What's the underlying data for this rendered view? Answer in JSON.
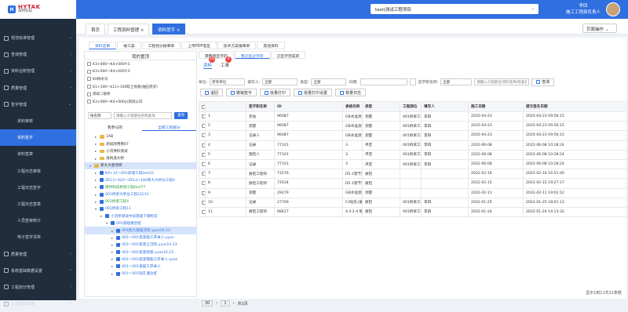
{
  "brand": {
    "name": "HYTAK",
    "sub": "海特科技"
  },
  "header": {
    "project": "test(测试工程项目",
    "user_name": "李四",
    "user_role": "施工工程部负责人"
  },
  "sidebar": [
    {
      "label": "规范标准管理",
      "arrow": "›"
    },
    {
      "label": "查询管理",
      "arrow": "›"
    },
    {
      "label": "资料台账管理",
      "arrow": "›"
    },
    {
      "label": "质量管理",
      "arrow": "›"
    },
    {
      "label": "签字管理",
      "arrow": "⌄"
    },
    {
      "label": "资料审核",
      "sub": true
    },
    {
      "label": "资料签字",
      "sub": true,
      "active": true
    },
    {
      "label": "资料签章",
      "sub": true
    },
    {
      "label": "工程日志审核",
      "sub": true
    },
    {
      "label": "工程日志签字",
      "sub": true
    },
    {
      "label": "工程日志签章",
      "sub": true
    },
    {
      "label": "人员签审统计",
      "sub": true
    },
    {
      "label": "电子签字清单",
      "sub": true
    },
    {
      "label": "质量管理",
      "arrow": "›"
    },
    {
      "label": "系统基础数据设置",
      "arrow": "›"
    },
    {
      "label": "工程划分管理",
      "arrow": "›"
    },
    {
      "label": "工程基础数据",
      "arrow": "›"
    }
  ],
  "tabs": [
    {
      "label": "首页",
      "close": ""
    },
    {
      "label": "工程资料管理",
      "close": "×"
    },
    {
      "label": "资料签字",
      "close": "×",
      "active": true
    }
  ],
  "page_ops": "页面操作 ⌄",
  "subtabs": [
    "资料签审",
    "竣工案",
    "工程划分报审章",
    "上传PDF电签",
    "技术方案报审单",
    "其他资料"
  ],
  "left_panel": {
    "title": "我的置顶",
    "pinned": [
      "K3+000～K4+000Y-3",
      "K3+000～K4+000Y-3",
      "K0桥水沟",
      "K1+100～k11+100软土地基(抽石挤淤)",
      "测试二级桥",
      "K3+000～K4+000y(测试公司"
    ],
    "filter_field": "按名称",
    "filter_placeholder": "请输入工程部位名称查询",
    "query": "查询",
    "tabs": [
      "我参与的",
      "全部工程部分"
    ],
    "tree": [
      {
        "t": "1AB",
        "lvl": 1,
        "type": "folder"
      },
      {
        "t": "测试改用例07",
        "lvl": 1,
        "type": "folder"
      },
      {
        "t": "小流供料测试",
        "lvl": 1,
        "type": "folder"
      },
      {
        "t": "溪杭溪大桥",
        "lvl": 1,
        "type": "folder"
      },
      {
        "t": "新大大金项目",
        "lvl": 0,
        "type": "folder",
        "open": true,
        "sel": true
      },
      {
        "t": "K0+12～001新建工程test22",
        "lvl": 1,
        "type": "doc",
        "c": "blue"
      },
      {
        "t": "ZK13+920～ZK14+180新大大桥分工程4",
        "lvl": 1,
        "type": "doc",
        "c": "blue"
      },
      {
        "t": "南桥科技桥梁工程test77",
        "lvl": 1,
        "type": "doc",
        "c": "green"
      },
      {
        "t": "001桥梁大单位工程ii2233",
        "lvl": 1,
        "type": "doc",
        "c": "blue"
      },
      {
        "t": "001桥梁工程4",
        "lvl": 1,
        "type": "doc",
        "c": "green"
      },
      {
        "t": "001桥梁工程11",
        "lvl": 1,
        "type": "doc",
        "c": "blue",
        "open": true
      },
      {
        "t": "小流桥测试中段基础下摩构造",
        "lvl": 2,
        "type": "doc",
        "c": "blue"
      },
      {
        "t": "001基础重造桩",
        "lvl": 3,
        "type": "doc",
        "c": "blue",
        "open": true
      },
      {
        "t": "001桩大基础浇筑-yyos10.23",
        "lvl": 4,
        "type": "doc",
        "c": "blue",
        "sel": true
      },
      {
        "t": "001～001桩基础工序录入-yyos",
        "lvl": 4,
        "type": "doc",
        "c": "blue"
      },
      {
        "t": "001～001桩基土浇筑-yyos10.23",
        "lvl": 4,
        "type": "doc",
        "c": "blue"
      },
      {
        "t": "001～001桩基地基-yyos10.23",
        "lvl": 4,
        "type": "doc",
        "c": "blue"
      },
      {
        "t": "001～001桩基钢筋工序录入-yyos",
        "lvl": 4,
        "type": "doc",
        "c": "blue"
      },
      {
        "t": "001～001基础工序录入",
        "lvl": 4,
        "type": "doc",
        "c": "blue"
      },
      {
        "t": "001～001钻孔灌注桩",
        "lvl": 4,
        "type": "doc",
        "c": "blue"
      }
    ]
  },
  "right_panel": {
    "tabs": [
      "需要我签字的",
      "我已签过字的",
      "已签字完成的"
    ],
    "mini_tabs": [
      {
        "label": "资料",
        "badge": "16"
      },
      {
        "label": "工单",
        "badge": "0"
      }
    ],
    "filters": {
      "unit_label": "单位:",
      "unit_value": "所有单位",
      "filler_label": "填写人:",
      "filler_value": "全部",
      "type_label": "类型:",
      "type_value": "全部",
      "date_label": "日期:",
      "date_from": "",
      "date_to": "",
      "sign_label": "签字职名称:",
      "sign_value": "全部",
      "search_placeholder": "请输入工程部位/资料名称/检查日期",
      "search_btn": "查询"
    },
    "buttons": [
      "退回",
      "撤销签字",
      "批量打印",
      "批量打印设置",
      "数量日志"
    ],
    "columns": [
      "签字职名称",
      "ID",
      "表格名称",
      "类型",
      "工程部位",
      "填写人",
      "施工日期",
      "提交签名日期",
      "操作"
    ],
    "rows": [
      {
        "role": "旁站",
        "id": "96087",
        "name": "GB水准测量记录表",
        "type": "测量",
        "part": "001桥梁工程/001～0",
        "filler": "李四",
        "date": "2025-04-23",
        "submit": "2025-04-23 09:56:15",
        "ops": [
          "查看PDF文件",
          "查看资料详情",
          "更多"
        ]
      },
      {
        "role": "测量",
        "id": "96087",
        "name": "GB水准测量记录表",
        "type": "测量",
        "part": "001桥梁工程/001～0",
        "filler": "李四",
        "date": "2025-04-23",
        "submit": "2025-04-23 09:56:15",
        "ops": [
          "查看PDF文件",
          "查看资料详情",
          "更多"
        ]
      },
      {
        "role": "记录人",
        "id": "96087",
        "name": "GB水准测量记录表",
        "type": "测量",
        "part": "001桥梁工程/001～0",
        "filler": "李四",
        "date": "2025-04-23",
        "submit": "2025-04-23 09:56:15",
        "ops": [
          "查看PDF文件",
          "查看资料详情",
          "更多"
        ]
      },
      {
        "role": "记录",
        "id": "77101",
        "name": "3",
        "type": "评定",
        "part": "001桥梁工程5/0年批量",
        "filler": "李四",
        "date": "2022-06-08",
        "submit": "2022-06-08 10:28:24",
        "ops": [
          "查看PDF文件",
          "查看资料详情",
          "更多"
        ]
      },
      {
        "role": "施检人",
        "id": "77101",
        "name": "3",
        "type": "评定",
        "part": "001桥梁工程5/0年批量",
        "filler": "李四",
        "date": "2022-06-08",
        "submit": "2022-06-08 10:28:24",
        "ops": [
          "查看PDF文件",
          "查看资料详情",
          "更多"
        ]
      },
      {
        "role": "记录",
        "id": "77101",
        "name": "3",
        "type": "评定",
        "part": "001桥梁工程5/0年批量",
        "filler": "李四",
        "date": "2022-06-08",
        "submit": "2022-06-08 10:28:24",
        "ops": [
          "查看PDF文件",
          "查看资料详情",
          "更多"
        ]
      },
      {
        "role": "质检工程师",
        "id": "73576",
        "name": "D5.1管节预制质量检验表1",
        "type": "质检",
        "part": "",
        "filler": "",
        "date": "2022-02-16",
        "submit": "2022-02-16 16:51:40",
        "ops": [
          "查看PDF文件",
          "查看资料详情",
          "更多"
        ]
      },
      {
        "role": "质检工程师",
        "id": "73534",
        "name": "D5.1管节预制质量检验表1",
        "type": "质检",
        "part": "",
        "filler": "",
        "date": "2022-02-15",
        "submit": "2022-02-15 19:27:17",
        "ops": [
          "查看PDF文件",
          "查看资料详情",
          "更多"
        ]
      },
      {
        "role": "测量",
        "id": "29279",
        "name": "GB水准测量记录表",
        "type": "测量",
        "part": "",
        "filler": "",
        "date": "2022-02-11",
        "submit": "2022-02-11 19:02:12",
        "ops": [
          "查看PDF文件",
          "查看资料详情",
          "更多"
        ]
      },
      {
        "role": "记录",
        "id": "27709",
        "name": "C4钻孔(灌浆) 施度记录表",
        "type": "质检",
        "part": "001桥梁工程/001～0",
        "filler": "李四",
        "date": "2022-01-25",
        "submit": "2022-01-25 18:01:13",
        "ops": [
          "查看PDF文件",
          "查看资料详情",
          "更多"
        ]
      },
      {
        "role": "质检工程师",
        "id": "68617",
        "name": "4.4.2-4 粘接性",
        "type": "质检",
        "part": "001桥梁工程/001～0",
        "filler": "李四",
        "date": "2022-01-24",
        "submit": "2022-01-24 14:13:32",
        "ops": [
          "查看PDF文件",
          "查看资料详情",
          "更多"
        ]
      }
    ],
    "pager": {
      "size": "30",
      "prev": "‹",
      "page": "1",
      "next": "›",
      "jump": "共1页"
    },
    "total": "显示1到11共11条数"
  }
}
